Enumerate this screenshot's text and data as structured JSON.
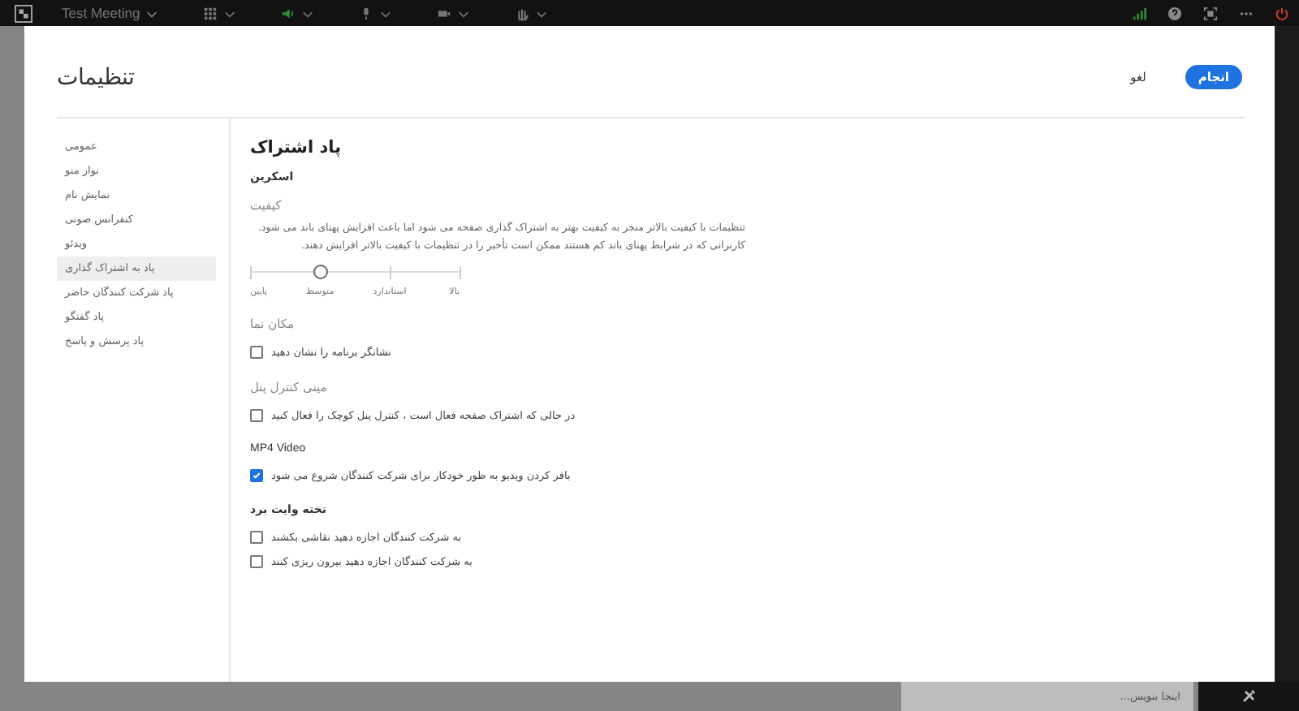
{
  "top_bar": {
    "meeting_title": "Test Meeting"
  },
  "dialog": {
    "title": "تنظیمات",
    "buttons": [
      {
        "label": "انجام",
        "kind": "primary"
      },
      {
        "label": "لغو",
        "kind": "text"
      }
    ],
    "sidebar": {
      "items": [
        {
          "label": "عمومی",
          "selected": false
        },
        {
          "label": "نوار منو",
          "selected": false
        },
        {
          "label": "نمایش نام",
          "selected": false
        },
        {
          "label": "کنفرانس صوتی",
          "selected": false
        },
        {
          "label": "ویدئو",
          "selected": false
        },
        {
          "label": "پاد به اشتراک گذاری",
          "selected": true
        },
        {
          "label": "پاد شرکت کنندگان حاضر",
          "selected": false
        },
        {
          "label": "پاد گفتگو",
          "selected": false
        },
        {
          "label": "پاد پرسش و پاسخ",
          "selected": false
        }
      ]
    },
    "content": {
      "heading": "پاد اشتراک",
      "sections": [
        {
          "kind": "subheading",
          "label": "اسکرین"
        },
        {
          "kind": "slider",
          "label": "کیفیت",
          "description": [
            "تنظیمات با کیفیت بالاتر منجر به کیفیت بهتر به اشتراک گذاری صفحه می شود اما باعث افزایش پهنای باند می شود.",
            "کاربرانی که در شرایط پهنای باند کم هستند ممکن است تأخیر را در تنظیمات با کیفیت بالاتر افزایش دهند."
          ],
          "level": 0.333,
          "ticks": [
            "بالا",
            "استاندارد",
            "متوسط",
            "پایین"
          ]
        },
        {
          "kind": "checkboxes",
          "label": "مکان نما",
          "muted": true,
          "bold": false,
          "items": [
            {
              "label": "نشانگر برنامه را نشان دهید",
              "checked": false
            }
          ]
        },
        {
          "kind": "checkboxes",
          "label": "مینی کنترل پنل",
          "muted": true,
          "bold": false,
          "items": [
            {
              "label": "در حالی که اشتراک صفحه فعال است ، کنترل پنل کوچک را فعال کنید",
              "checked": false
            }
          ]
        },
        {
          "kind": "checkboxes",
          "label": "MP4 Video",
          "muted": false,
          "bold": false,
          "items": [
            {
              "label": "بافر کردن ویدیو به طور خودکار برای شرکت کنندگان شروع می شود",
              "checked": true
            }
          ]
        },
        {
          "kind": "checkboxes",
          "label": "تخته وایت برد",
          "muted": false,
          "bold": true,
          "items": [
            {
              "label": "به شرکت کنندگان اجازه دهید نقاشی بکشند",
              "checked": false
            },
            {
              "label": "به شرکت کنندگان اجازه دهید بیرون ریزی کنند",
              "checked": false
            }
          ]
        }
      ]
    }
  },
  "chat_input": {
    "placeholder": "اینجا بنویس..."
  }
}
